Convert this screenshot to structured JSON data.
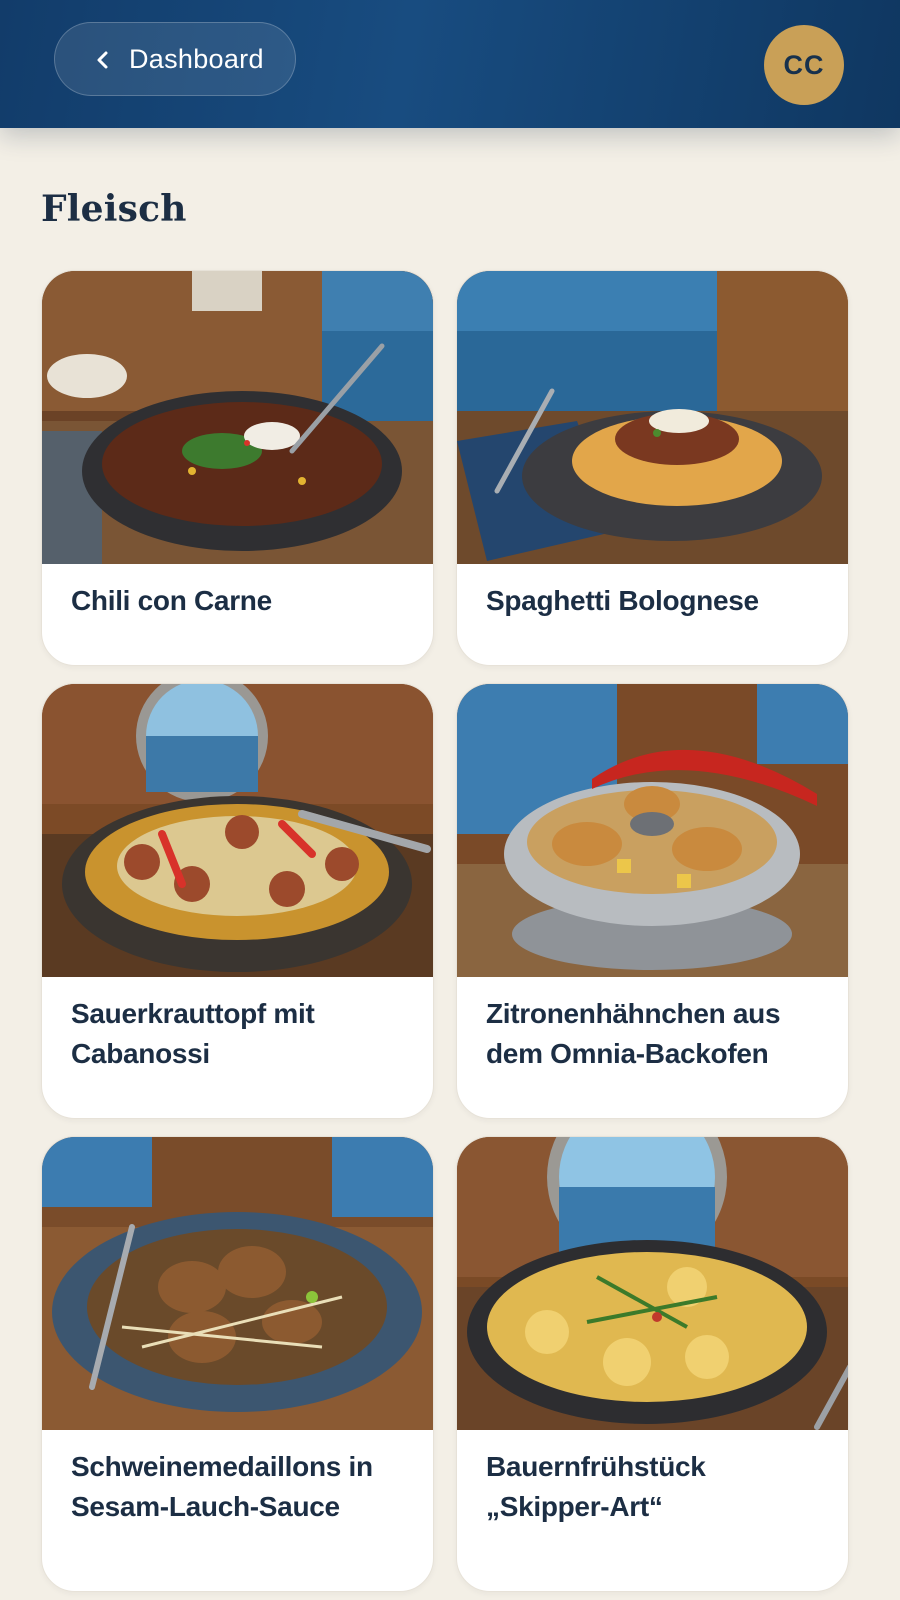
{
  "header": {
    "back_label": "Dashboard",
    "avatar_initials": "CC"
  },
  "section": {
    "title": "Fleisch"
  },
  "recipes": [
    {
      "title": "Chili con Carne"
    },
    {
      "title": "Spaghetti Bolognese"
    },
    {
      "title": "Sauerkrauttopf mit Cabanossi"
    },
    {
      "title": "Zitronenhähnchen aus dem Omnia-Backofen"
    },
    {
      "title": "Schweinemedaillons in Sesam-Lauch-Sauce"
    },
    {
      "title": "Bauernfrühstück „Skipper-Art“"
    }
  ],
  "colors": {
    "header": "#134272",
    "background": "#f3efe6",
    "avatar": "#c9a057",
    "text": "#1c2e44"
  },
  "icons": {
    "back": "chevron-left-icon"
  }
}
